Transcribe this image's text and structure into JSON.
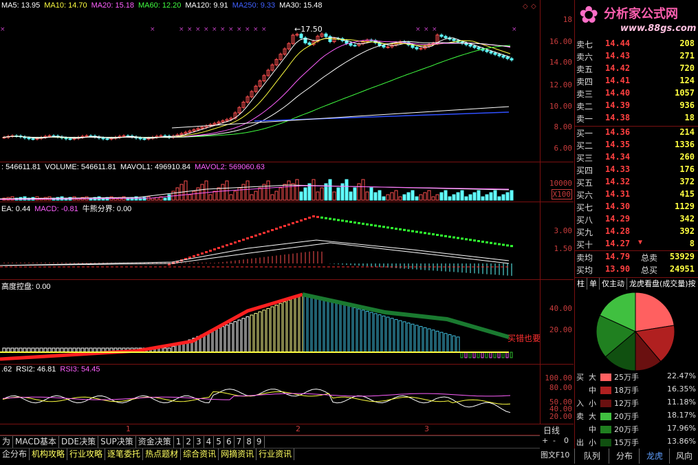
{
  "main_legend": [
    {
      "text": "MA5: 13.95",
      "color": "#ffffff"
    },
    {
      "text": "MA10: 14.70",
      "color": "#ffff40"
    },
    {
      "text": "MA20: 15.18",
      "color": "#ff60ff"
    },
    {
      "text": "MA60: 12.20",
      "color": "#40ff40"
    },
    {
      "text": "MA120: 9.91",
      "color": "#ffffff"
    },
    {
      "text": "MA250: 9.33",
      "color": "#4060ff"
    },
    {
      "text": "MA30: 15.48",
      "color": "#ffffff"
    }
  ],
  "main_axis": [
    "18",
    "16.00",
    "14.00",
    "12.00",
    "10.00",
    "8.00",
    "6.00"
  ],
  "peak_label": "17.50",
  "vol_legend": [
    {
      "text": ": 546611.81",
      "color": "#ffffff"
    },
    {
      "text": "VOLUME: 546611.81",
      "color": "#ffffff"
    },
    {
      "text": "MAVOL1: 496910.84",
      "color": "#ffffff"
    },
    {
      "text": "MAVOL2: 569060.63",
      "color": "#ff60ff"
    }
  ],
  "vol_axis": [
    "10000",
    "X100"
  ],
  "macd_legend": [
    {
      "text": "EA: 0.44",
      "color": "#ffffff"
    },
    {
      "text": "MACD: -0.81",
      "color": "#ff60ff"
    },
    {
      "text": "牛熊分界: 0.00",
      "color": "#ffffff"
    }
  ],
  "macd_axis": [
    "3.00",
    "1.50"
  ],
  "ctrl_legend": [
    {
      "text": "高度控盘: 0.00",
      "color": "#ffffff"
    }
  ],
  "ctrl_axis": [
    "40.00",
    "20.00"
  ],
  "ctrl_annotation": "买错也要",
  "rsi_legend": [
    {
      "text": ".62",
      "color": "#ffffff"
    },
    {
      "text": "RSI2: 46.81",
      "color": "#ffffff"
    },
    {
      "text": "RSI3: 54.45",
      "color": "#ff60ff"
    }
  ],
  "rsi_axis": [
    "100.00",
    "80.00",
    "50.00",
    "40.00",
    "20.00"
  ],
  "x_markers": [
    "1",
    "2",
    "3"
  ],
  "logo": {
    "main": "分析家公式网",
    "url": "www.88gs.com"
  },
  "sell_orders": [
    {
      "label": "卖七",
      "price": "14.44",
      "vol": "208"
    },
    {
      "label": "卖六",
      "price": "14.43",
      "vol": "271"
    },
    {
      "label": "卖五",
      "price": "14.42",
      "vol": "720"
    },
    {
      "label": "卖四",
      "price": "14.41",
      "vol": "124"
    },
    {
      "label": "卖三",
      "price": "14.40",
      "vol": "1057"
    },
    {
      "label": "卖二",
      "price": "14.39",
      "vol": "936"
    },
    {
      "label": "卖一",
      "price": "14.38",
      "vol": "18"
    }
  ],
  "buy_orders": [
    {
      "label": "买一",
      "price": "14.36",
      "vol": "214"
    },
    {
      "label": "买二",
      "price": "14.35",
      "vol": "1336"
    },
    {
      "label": "买三",
      "price": "14.34",
      "vol": "260"
    },
    {
      "label": "买四",
      "price": "14.33",
      "vol": "176"
    },
    {
      "label": "买五",
      "price": "14.32",
      "vol": "372"
    },
    {
      "label": "买六",
      "price": "14.31",
      "vol": "415"
    },
    {
      "label": "买七",
      "price": "14.30",
      "vol": "1129"
    },
    {
      "label": "买八",
      "price": "14.29",
      "vol": "342"
    },
    {
      "label": "买九",
      "price": "14.28",
      "vol": "392"
    },
    {
      "label": "买十",
      "price": "14.27",
      "vol": "8",
      "flag": "⁸"
    }
  ],
  "summary": [
    {
      "label": "卖均",
      "price": "14.79",
      "tlabel": "总卖",
      "vol": "53929"
    },
    {
      "label": "买均",
      "price": "13.90",
      "tlabel": "总买",
      "vol": "24951"
    }
  ],
  "donut_tabs": [
    "柱",
    "单",
    "仅主动",
    "龙虎看盘(成交量)按"
  ],
  "flows": [
    {
      "side": "买",
      "size": "大",
      "color": "#ff6060",
      "amount": "25万手",
      "pct": "22.47%",
      "value": 22.47
    },
    {
      "side": "",
      "size": "中",
      "color": "#b02020",
      "amount": "18万手",
      "pct": "16.35%",
      "value": 16.35
    },
    {
      "side": "入",
      "size": "小",
      "color": "#6a1010",
      "amount": "12万手",
      "pct": "11.18%",
      "value": 11.18
    },
    {
      "side": "卖",
      "size": "大",
      "color": "#40c040",
      "amount": "20万手",
      "pct": "18.17%",
      "value": 18.17
    },
    {
      "side": "",
      "size": "中",
      "color": "#208020",
      "amount": "20万手",
      "pct": "17.96%",
      "value": 17.96
    },
    {
      "side": "出",
      "size": "小",
      "color": "#105010",
      "amount": "15万手",
      "pct": "13.86%",
      "value": 13.86
    }
  ],
  "bottom_tabs1": [
    "为",
    "MACD基本",
    "DDE决策",
    "SUP决策",
    "资金决策",
    "1",
    "2",
    "3",
    "4",
    "5",
    "6",
    "7",
    "8",
    "9"
  ],
  "bottom_tabs2": [
    "企分布",
    "机构攻略",
    "行业攻略",
    "逐笔委托",
    "热点题材",
    "综合资讯",
    "网摘资讯",
    "行业资讯"
  ],
  "right_controls": {
    "line_label": "日线",
    "plus": "+",
    "minus": "-",
    "zero": "0",
    "doc": "图文F10"
  },
  "right_tabs": [
    "队列",
    "分布",
    "龙虎",
    "风向"
  ]
}
